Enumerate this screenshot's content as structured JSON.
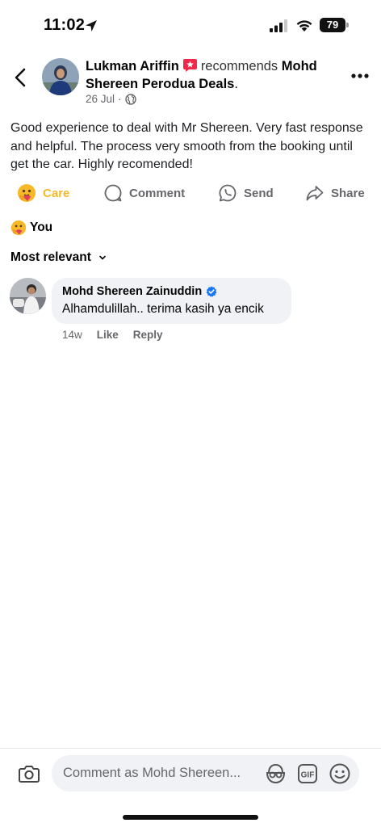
{
  "status_bar": {
    "time": "11:02",
    "battery": "79"
  },
  "post": {
    "author": "Lukman Ariffin",
    "verb": "recommends",
    "page": "Mohd Shereen Perodua Deals",
    "date": "26 Jul",
    "body": "Good experience to deal with Mr Shereen. Very fast response and helpful. The process very smooth from the booking until get the car. Highly recomended!"
  },
  "actions": {
    "care": "Care",
    "comment": "Comment",
    "send": "Send",
    "share": "Share"
  },
  "reactions": {
    "label": "You"
  },
  "sort": {
    "label": "Most relevant"
  },
  "comment": {
    "author": "Mohd Shereen Zainuddin",
    "text": "Alhamdulillah.. terima kasih ya encik",
    "age": "14w",
    "like": "Like",
    "reply": "Reply"
  },
  "composer": {
    "placeholder": "Comment as Mohd Shereen..."
  },
  "colors": {
    "care": "#f7b928",
    "secondary_text": "#65676b",
    "bubble": "#f0f2f5",
    "verified": "#1877f2",
    "recommend": "#f02849"
  }
}
